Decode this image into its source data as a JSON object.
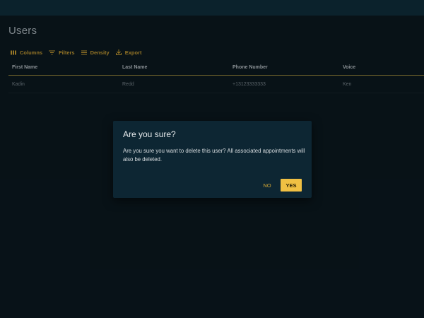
{
  "page": {
    "title": "Users"
  },
  "toolbar": {
    "columns_label": "Columns",
    "filters_label": "Filters",
    "density_label": "Density",
    "export_label": "Export"
  },
  "grid": {
    "headers": [
      "First Name",
      "Last Name",
      "Phone Number",
      "Voice"
    ],
    "rows": [
      [
        "Kadin",
        "Redd",
        "+13123333333",
        "Ken"
      ]
    ]
  },
  "dialog": {
    "title": "Are you sure?",
    "body": "Are you sure you want to delete this user? All associated appointments will also be deleted.",
    "no_label": "NO",
    "yes_label": "YES"
  },
  "colors": {
    "background": "#0a161d",
    "topbar": "#0e2a36",
    "accent": "#f0c043",
    "accent_text": "#b7902f",
    "dialog": "#0d2633"
  },
  "icons": {
    "columns": "columns-icon",
    "filters": "filter-icon",
    "density": "density-icon",
    "export": "export-icon"
  }
}
